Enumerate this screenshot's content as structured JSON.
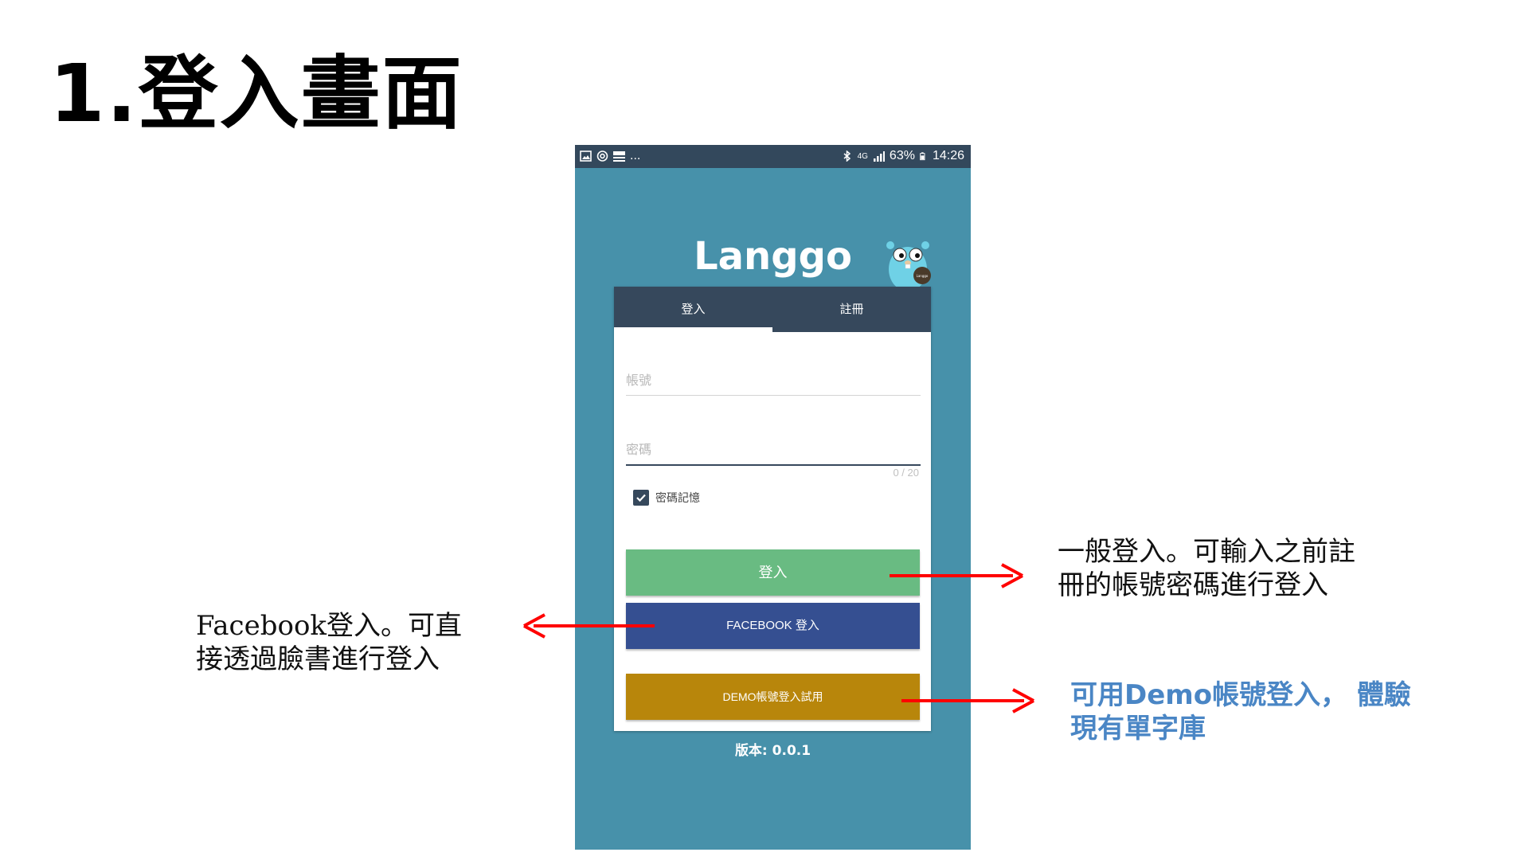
{
  "slide": {
    "title": "1.登入畫面"
  },
  "status_bar": {
    "left_overflow": "...",
    "network": "4G",
    "battery": "63%",
    "time": "14:26"
  },
  "app": {
    "title": "Langgo",
    "mascot_badge": "Langgo",
    "tabs": [
      {
        "label": "登入"
      },
      {
        "label": "註冊"
      }
    ],
    "account_placeholder": "帳號",
    "password_placeholder": "密碼",
    "password_counter": "0 / 20",
    "remember_label": "密碼記憶",
    "remember_checked": true,
    "login_button": "登入",
    "facebook_button": "FACEBOOK 登入",
    "demo_button": "DEMO帳號登入試用",
    "version": "版本: 0.0.1"
  },
  "annotations": {
    "facebook": {
      "line1": "Facebook登入。可直",
      "line2": "接透過臉書進行登入"
    },
    "login": {
      "line1": "一般登入。可輸入之前註",
      "line2": "冊的帳號密碼進行登入"
    },
    "demo": {
      "line1": "可用Demo帳號登入， 體驗",
      "line2": "現有單字庫"
    }
  },
  "colors": {
    "phone_bg": "#4791aa",
    "status_bar": "#33485c",
    "tabs_bg": "#36485c",
    "login_button": "#69bb82",
    "facebook_button": "#354f91",
    "demo_button": "#b8860b",
    "arrow": "#ff0000",
    "demo_note": "#4a86c5"
  }
}
